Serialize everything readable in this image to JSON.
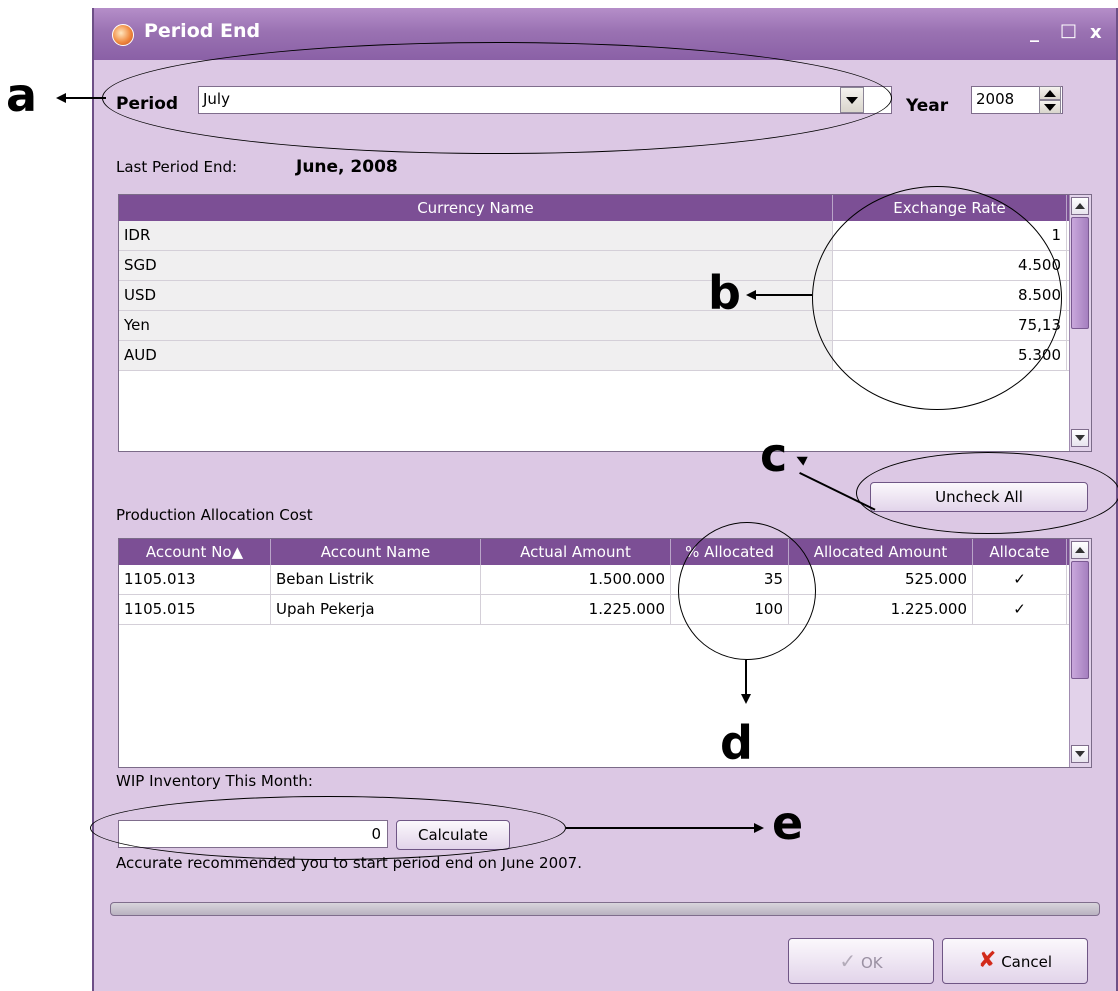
{
  "window": {
    "title": "Period End",
    "minimize": "_",
    "maximize": "□",
    "close": "x"
  },
  "period": {
    "label": "Period",
    "value": "July",
    "year_label": "Year",
    "year_value": "2008"
  },
  "last_period": {
    "label": "Last Period End:",
    "value": "June, 2008"
  },
  "currency_grid": {
    "headers": [
      "Currency Name",
      "Exchange Rate"
    ],
    "rows": [
      {
        "name": "IDR",
        "rate": "1"
      },
      {
        "name": "SGD",
        "rate": "4.500"
      },
      {
        "name": "USD",
        "rate": "8.500"
      },
      {
        "name": "Yen",
        "rate": "75,13"
      },
      {
        "name": "AUD",
        "rate": "5.300"
      }
    ]
  },
  "uncheck_all_label": "Uncheck All",
  "production": {
    "label": "Production Allocation Cost",
    "headers": [
      "Account No▲",
      "Account Name",
      "Actual Amount",
      "% Allocated",
      "Allocated Amount",
      "Allocate"
    ],
    "rows": [
      {
        "no": "1105.013",
        "name": "Beban Listrik",
        "actual": "1.500.000",
        "pct": "35",
        "allocated": "525.000",
        "check": "✓"
      },
      {
        "no": "1105.015",
        "name": "Upah Pekerja",
        "actual": "1.225.000",
        "pct": "100",
        "allocated": "1.225.000",
        "check": "✓"
      }
    ]
  },
  "wip": {
    "label": "WIP Inventory This Month:",
    "value": "0",
    "calculate_label": "Calculate",
    "recommendation": "Accurate recommended you to start period end on June 2007."
  },
  "buttons": {
    "ok": "OK",
    "cancel": "Cancel"
  },
  "annotations": {
    "a": "a",
    "b": "b",
    "c": "c",
    "d": "d",
    "e": "e"
  }
}
